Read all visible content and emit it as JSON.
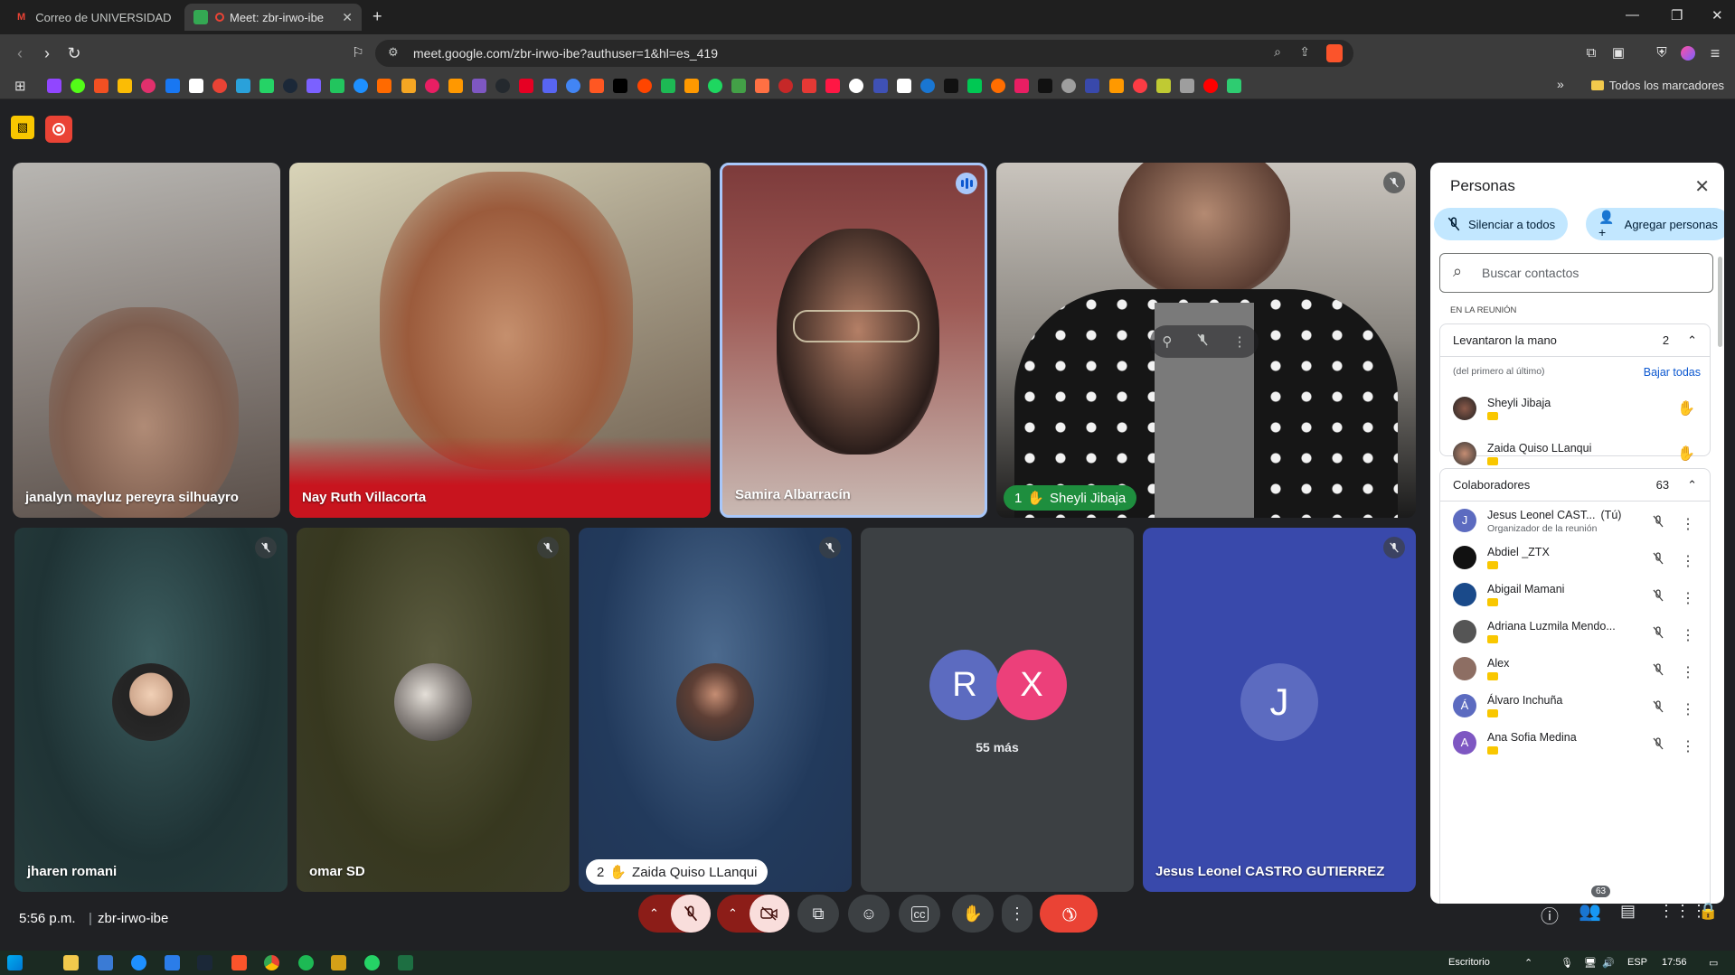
{
  "colors": {
    "meet_bg": "#202124",
    "panel_bg": "#ffffff",
    "hangup": "#ea4335",
    "mic_off": "#f9dedc",
    "pill": "#c2e7ff",
    "link": "#0b57d0",
    "hand_chip": "#1e8e3e"
  },
  "browser": {
    "tabs": [
      {
        "label": "Correo de UNIVERSIDAD PRIVADA DE",
        "icon": "gmail-icon"
      },
      {
        "label": "Meet: zbr-irwo-ibe",
        "icon": "meet-icon"
      }
    ],
    "url": "meet.google.com/zbr-irwo-ibe?authuser=1&hl=es_419",
    "all_bookmarks": "Todos los marcadores"
  },
  "tiles": {
    "top": [
      {
        "name": "janalyn mayluz pereyra silhuayro"
      },
      {
        "name": "Nay Ruth Villacorta"
      },
      {
        "name": "Samira Albarracín"
      },
      {
        "name": "Sheyli Jibaja",
        "hand": "1"
      }
    ],
    "bottom": [
      {
        "name": "jharen romani"
      },
      {
        "name": "omar SD"
      },
      {
        "name": "Zaida Quiso LLanqui",
        "hand": "2"
      },
      {
        "more": "55 más",
        "a1": "R",
        "a2": "X"
      },
      {
        "name": "Jesus Leonel CASTRO GUTIERREZ",
        "initial": "J"
      }
    ]
  },
  "panel": {
    "title": "Personas",
    "mute_all": "Silenciar a todos",
    "add_people": "Agregar personas",
    "search_placeholder": "Buscar contactos",
    "in_meeting": "EN LA REUNIÓN",
    "raised": {
      "label": "Levantaron la mano",
      "count": "2",
      "order": "(del primero al último)",
      "lower_all": "Bajar todas",
      "people": [
        "Sheyli Jibaja",
        "Zaida Quiso LLanqui"
      ]
    },
    "collab": {
      "label": "Colaboradores",
      "count": "63",
      "people": [
        {
          "name": "Jesus Leonel CAST...",
          "you": "(Tú)",
          "sub": "Organizador de la reunión",
          "initial": "J",
          "color": "#5c6bc0"
        },
        {
          "name": "Abdiel _ZTX",
          "initial": "",
          "color": "#111111"
        },
        {
          "name": "Abigail Mamani",
          "initial": "",
          "color": "#1a4a8a"
        },
        {
          "name": "Adriana Luzmila Mendo...",
          "initial": "",
          "color": "#555555"
        },
        {
          "name": "Alex",
          "initial": "",
          "color": "#8d6e63"
        },
        {
          "name": "Álvaro Inchuña",
          "initial": "Á",
          "color": "#5c6bc0"
        },
        {
          "name": "Ana Sofia Medina",
          "initial": "A",
          "color": "#7e57c2"
        }
      ]
    }
  },
  "bottom": {
    "time": "5:56 p.m.",
    "code": "zbr-irwo-ibe",
    "people_badge": "63"
  },
  "taskbar": {
    "desktop": "Escritorio",
    "lang": "ESP",
    "clock": "17:56"
  }
}
